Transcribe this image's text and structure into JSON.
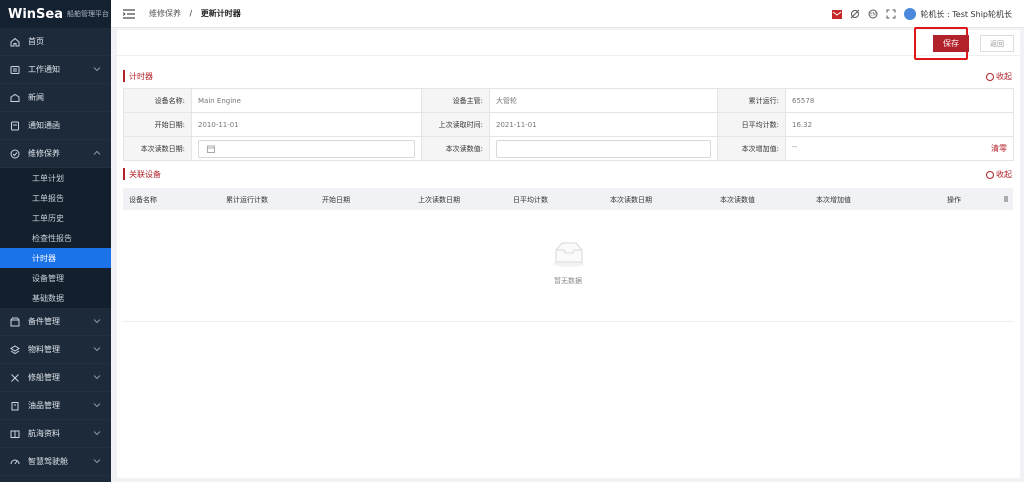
{
  "brand": {
    "logo": "WinSea",
    "subtitle": "船舶管理平台"
  },
  "sidebar": {
    "items": [
      {
        "label": "首页",
        "icon": "home-icon"
      },
      {
        "label": "工作通知",
        "icon": "list-icon"
      },
      {
        "label": "新闻",
        "icon": "news-icon"
      },
      {
        "label": "通知通函",
        "icon": "document-icon"
      },
      {
        "label": "维修保养",
        "icon": "check-circle-icon"
      }
    ],
    "submenu": [
      "工单计划",
      "工单报告",
      "工单历史",
      "检查性报告",
      "计时器",
      "设备管理",
      "基础数据"
    ],
    "lower_items": [
      {
        "label": "备件管理",
        "icon": "box-icon"
      },
      {
        "label": "物料管理",
        "icon": "layers-icon"
      },
      {
        "label": "修船管理",
        "icon": "tools-icon"
      },
      {
        "label": "油品管理",
        "icon": "oil-icon"
      },
      {
        "label": "航海资料",
        "icon": "book-icon"
      },
      {
        "label": "智慧驾驶舱",
        "icon": "dashboard-icon"
      }
    ]
  },
  "breadcrumb": {
    "parent": "维修保养",
    "separator": "/",
    "current": "更新计时器"
  },
  "topbar": {
    "user": "轮机长 : Test Ship轮机长"
  },
  "actions": {
    "save": "保存",
    "back": "返回"
  },
  "counter_section": {
    "title": "计时器",
    "collapse": "收起",
    "rows": [
      [
        {
          "label": "设备名称:",
          "value": "Main Engine"
        },
        {
          "label": "设备主管:",
          "value": "大管轮"
        },
        {
          "label": "累计运行:",
          "value": "65578"
        }
      ],
      [
        {
          "label": "开始日期:",
          "value": "2010-11-01"
        },
        {
          "label": "上次读取时间:",
          "value": "2021-11-01"
        },
        {
          "label": "日平均计数:",
          "value": "16.32"
        }
      ],
      [
        {
          "label": "本次读数日期:",
          "value": ""
        },
        {
          "label": "本次读数值:",
          "value": ""
        },
        {
          "label": "本次增加值:",
          "value": "--"
        }
      ]
    ],
    "clear": "清零"
  },
  "related_section": {
    "title": "关联设备",
    "collapse": "收起",
    "columns": [
      "设备名称",
      "累计运行计数",
      "开始日期",
      "上次读数日期",
      "日平均计数",
      "本次读数日期",
      "本次读数值",
      "本次增加值",
      "操作"
    ],
    "empty_text": "暂无数据"
  },
  "colors": {
    "accent": "#b2222a",
    "sidebar": "#1d2a3a",
    "active": "#1a73e8",
    "highlight": "#e0161b"
  }
}
